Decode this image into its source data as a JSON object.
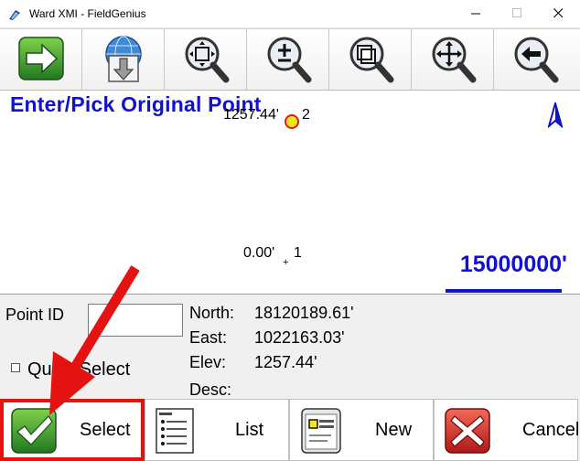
{
  "window": {
    "title": "Ward XMI - FieldGenius",
    "app_icon": "fieldgenius-app-icon",
    "controls": [
      "minimize-icon",
      "maximize-icon",
      "close-icon"
    ]
  },
  "toolbar": {
    "buttons": [
      {
        "name": "next-arrow",
        "icon": "green-right-arrow-icon"
      },
      {
        "name": "select-from-map",
        "icon": "globe-down-arrow-icon"
      },
      {
        "name": "zoom-extents",
        "icon": "zoom-extents-magnifier-icon"
      },
      {
        "name": "zoom-in-out",
        "icon": "zoom-plus-minus-magnifier-icon"
      },
      {
        "name": "zoom-window",
        "icon": "zoom-window-magnifier-icon"
      },
      {
        "name": "pan",
        "icon": "pan-magnifier-icon"
      },
      {
        "name": "zoom-previous",
        "icon": "zoom-previous-magnifier-icon"
      }
    ]
  },
  "map": {
    "prompt": "Enter/Pick Original Point",
    "points": [
      {
        "label": "1257.44'",
        "number": "2"
      },
      {
        "label": "0.00'",
        "number": "1"
      }
    ],
    "scale": "15000000'",
    "north_arrow_icon": "north-arrow-icon",
    "accent_color": "#1111d0"
  },
  "info": {
    "point_id_label": "Point ID",
    "point_id_value": "",
    "quick_select_label": "Quick Select",
    "north_label": "North:",
    "north_value": "18120189.61'",
    "east_label": "East:",
    "east_value": "1022163.03'",
    "elev_label": "Elev:",
    "elev_value": "1257.44'",
    "desc_label": "Desc:",
    "desc_value": ""
  },
  "buttons": {
    "select": "Select",
    "list": "List",
    "new": "New",
    "cancel": "Cancel"
  },
  "highlight_color": "#e51212"
}
